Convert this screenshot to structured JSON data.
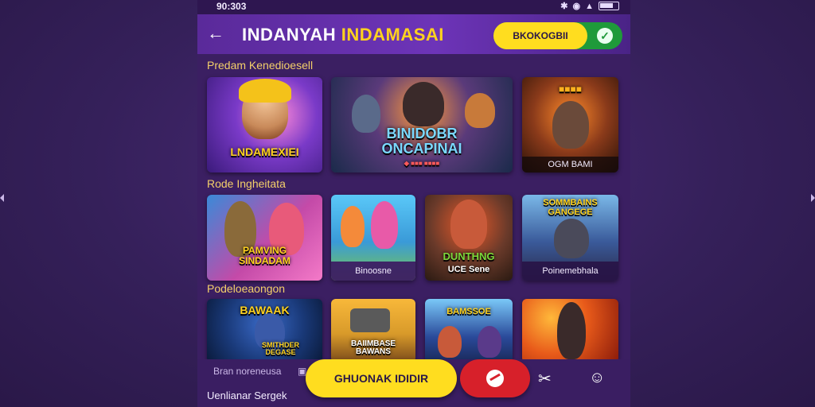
{
  "status": {
    "time": "90:303",
    "signal": "✱ ▼▲",
    "wifi": "◉"
  },
  "header": {
    "back": "←",
    "title_main": "INDANYAH ",
    "title_accent": "INDAMASAI",
    "cta_label": "BKOKOGBII",
    "cta_check": "✓"
  },
  "sections": [
    {
      "label": "Predam Kenedioesell"
    },
    {
      "label": "Rode Ingheitata"
    },
    {
      "label": "Podeloeaongon"
    }
  ],
  "row1": [
    {
      "caption": "LNDAMEXIEI",
      "bg": "#5b2ea8"
    },
    {
      "caption": "BINIDOBR\nONCAPINAI",
      "sub": "◆ ■■■ ■■■■",
      "bg": "#2a3a6a"
    },
    {
      "caption": "■■■■",
      "foot": "OGM BAMI",
      "bg": "#6a2a1a"
    }
  ],
  "row2": [
    {
      "caption": "PAMVING\nSINDADAM",
      "bg": "#c44aa8"
    },
    {
      "foot": "Binoosne",
      "bg": "#3a9ad8"
    },
    {
      "caption": "DUNTHNG",
      "foot": "UCE Sene",
      "bg": "#7a3a2a"
    },
    {
      "caption": "SOMMBAINS\nGANGEGE",
      "foot": "Poinemebhala",
      "bg": "#3a5a9a"
    }
  ],
  "row3": [
    {
      "caption": "BAWAAK",
      "sub": "SMITHDER\nDEGASE",
      "bg": "#1a3a7a"
    },
    {
      "caption": "BAIIMBASE\nBAWANS",
      "bg": "#d89a2a"
    },
    {
      "caption": "BAMSSOE",
      "bg": "#2a4a9a"
    },
    {
      "caption": "",
      "bg": "#c83a1a"
    }
  ],
  "bottom": {
    "mini_text": "Bran noreneusa",
    "mini_icon": "▣",
    "play_label": "GHUONAK IDIDIR",
    "footer_label": "Uenlianar Sergek"
  }
}
